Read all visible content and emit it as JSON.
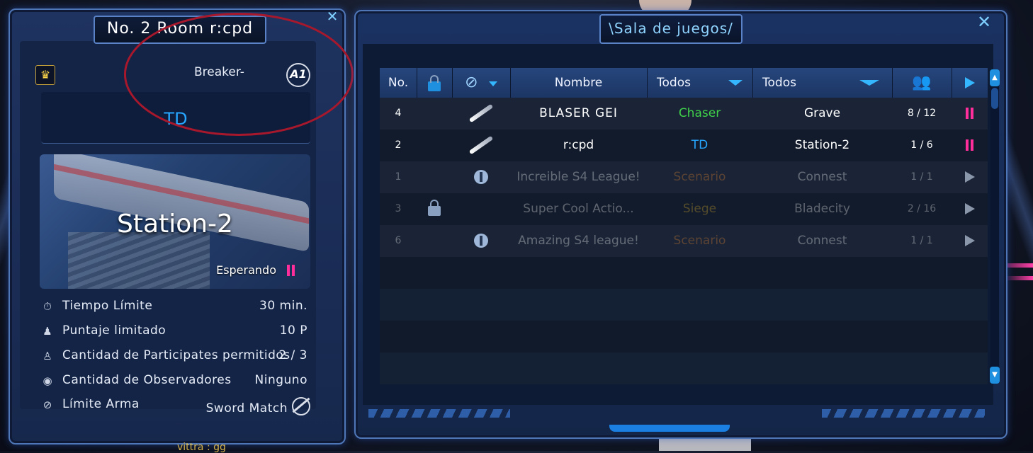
{
  "room": {
    "title": "No. 2 Room r:cpd",
    "host_name": "Breaker-",
    "rank_badge": "A1",
    "mode": "TD",
    "map_name": "Station-2",
    "status": "Esperando",
    "info": [
      {
        "icon": "stopwatch-icon",
        "label": "Tiempo Límite",
        "value": "30 min."
      },
      {
        "icon": "score-icon",
        "label": "Puntaje limitado",
        "value": "10 P"
      },
      {
        "icon": "person-icon",
        "label": "Cantidad de Participates permitidos",
        "value": "2 / 3"
      },
      {
        "icon": "eye-icon",
        "label": "Cantidad de Observadores",
        "value": "Ninguno"
      },
      {
        "icon": "ban-icon",
        "label": "Límite Arma",
        "value": "Sword Match"
      }
    ]
  },
  "bottom_chat": "vittra : gg",
  "games": {
    "title": "\\Sala de juegos/",
    "headers": {
      "no": "No.",
      "name": "Nombre",
      "mode_filter": "Todos",
      "map_filter": "Todos"
    },
    "rows": [
      {
        "no": "4",
        "icon": "knife",
        "name": "BLASER GEI",
        "mode": "Chaser",
        "mode_color": "#3fd14a",
        "map": "Grave",
        "players": "8 / 12",
        "state": "pause",
        "dim": false
      },
      {
        "no": "2",
        "icon": "knife",
        "name": "r:cpd",
        "mode": "TD",
        "mode_color": "#26a6ff",
        "map": "Station-2",
        "players": "1 / 6",
        "state": "pause",
        "dim": false
      },
      {
        "no": "1",
        "icon": "circle",
        "name": "Increible S4 League!",
        "mode": "Scenario",
        "mode_color": "#e8862e",
        "map": "Connest",
        "players": "1 / 1",
        "state": "play",
        "dim": true
      },
      {
        "no": "3",
        "icon": "lock",
        "name": "Super Cool Actio...",
        "mode": "Siege",
        "mode_color": "#e0b12e",
        "map": "Bladecity",
        "players": "2 / 16",
        "state": "play",
        "dim": true
      },
      {
        "no": "6",
        "icon": "circle",
        "name": "Amazing S4 league!",
        "mode": "Scenario",
        "mode_color": "#e8862e",
        "map": "Connest",
        "players": "1 / 1",
        "state": "play",
        "dim": true
      }
    ]
  }
}
